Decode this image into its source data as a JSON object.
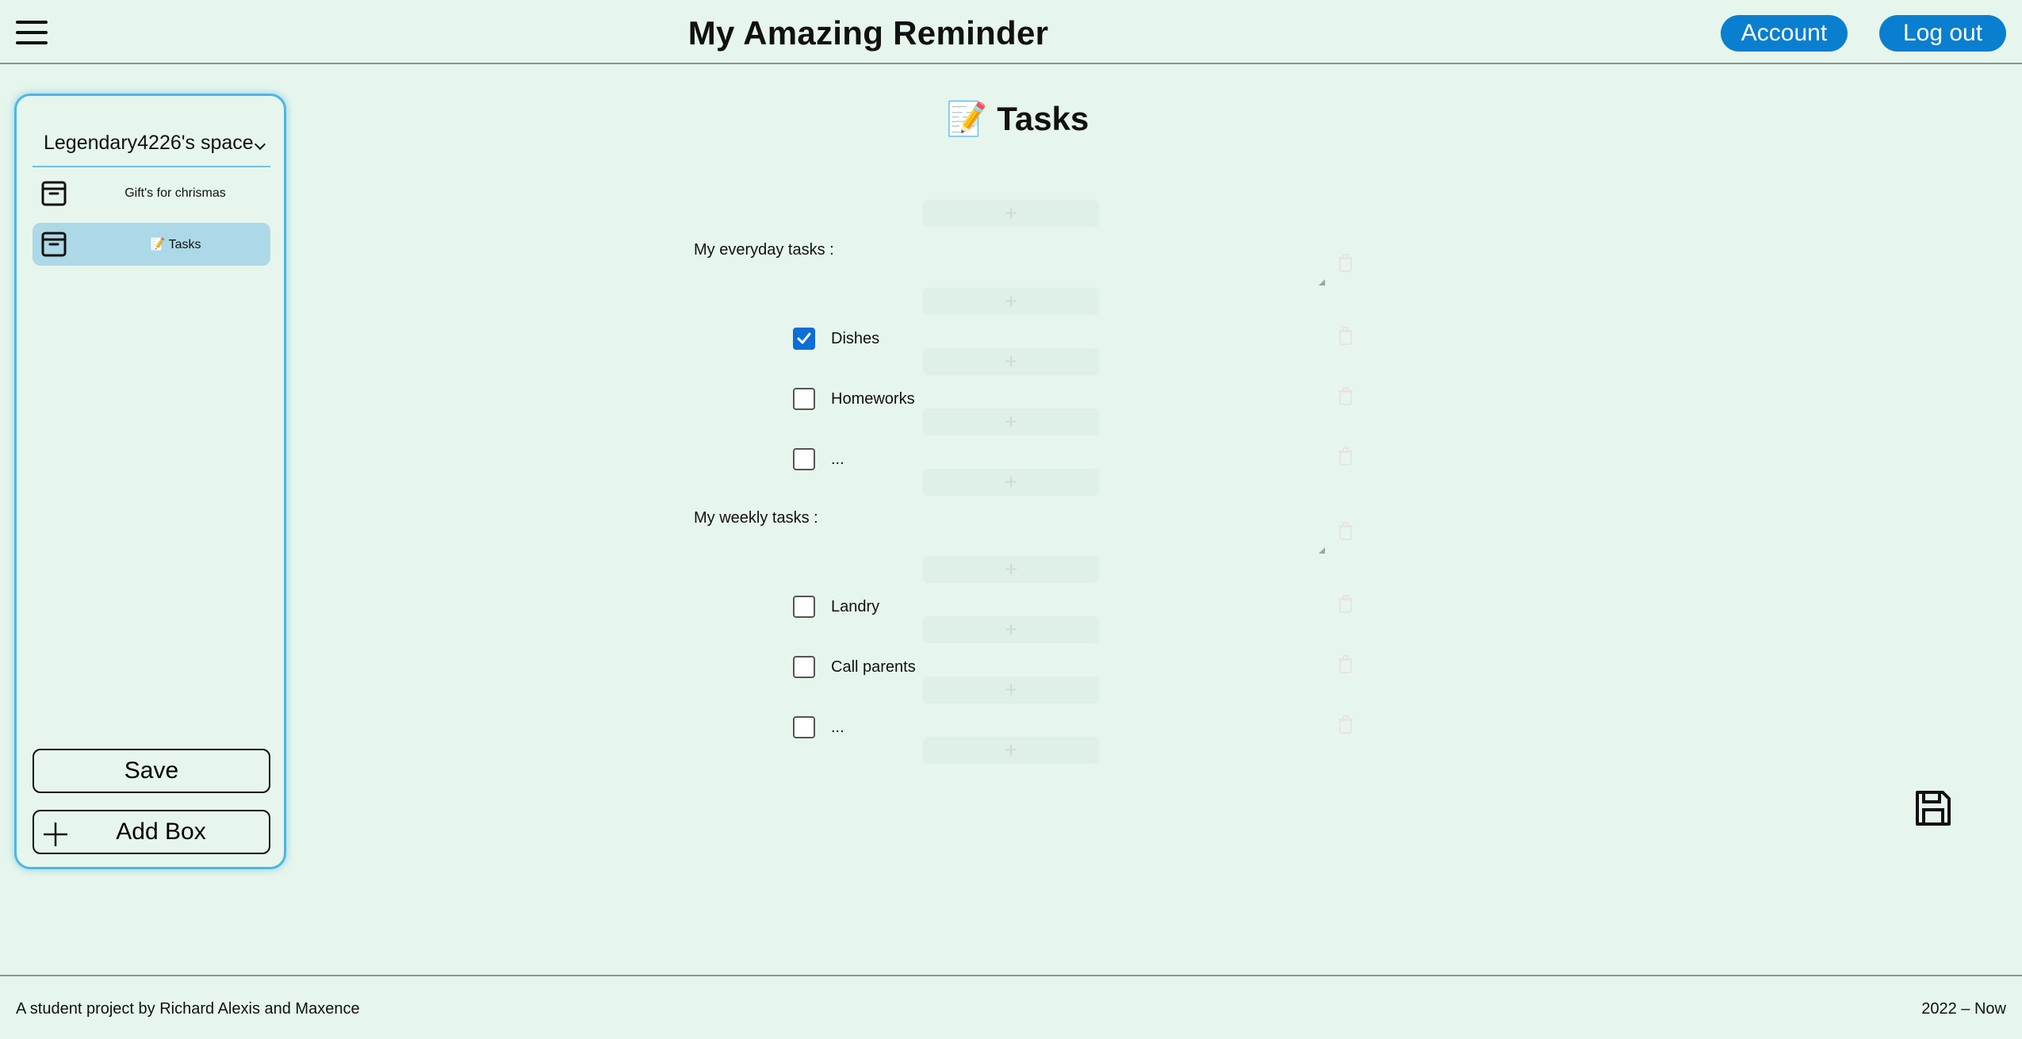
{
  "header": {
    "title": "My Amazing Reminder",
    "account_label": "Account",
    "logout_label": "Log out"
  },
  "sidebar": {
    "space_name": "Legendary4226's space",
    "boxes": [
      {
        "label": "Gift's for chrismas",
        "icon": "archive-box-icon",
        "active": false
      },
      {
        "label": "📝 Tasks",
        "icon": "archive-box-icon",
        "active": true
      }
    ],
    "save_label": "Save",
    "add_box_label": "Add Box"
  },
  "main": {
    "title": "Tasks",
    "title_icon": "📝",
    "sections": [
      {
        "label": "My everyday tasks :",
        "tasks": [
          {
            "text": "Dishes",
            "checked": true
          },
          {
            "text": "Homeworks",
            "checked": false
          },
          {
            "text": "...",
            "checked": false
          }
        ]
      },
      {
        "label": "My weekly tasks :",
        "tasks": [
          {
            "text": "Landry",
            "checked": false
          },
          {
            "text": "Call parents",
            "checked": false
          },
          {
            "text": "...",
            "checked": false
          }
        ]
      }
    ]
  },
  "footer": {
    "credits": "A student project by Richard Alexis and Maxence",
    "years": "2022 – Now"
  },
  "colors": {
    "background": "#e6f6ec",
    "accent": "#0a7fcf",
    "sidebar_border": "#4fb6e3",
    "active_box": "#acd8e8",
    "checkbox_checked": "#0b6edb"
  }
}
